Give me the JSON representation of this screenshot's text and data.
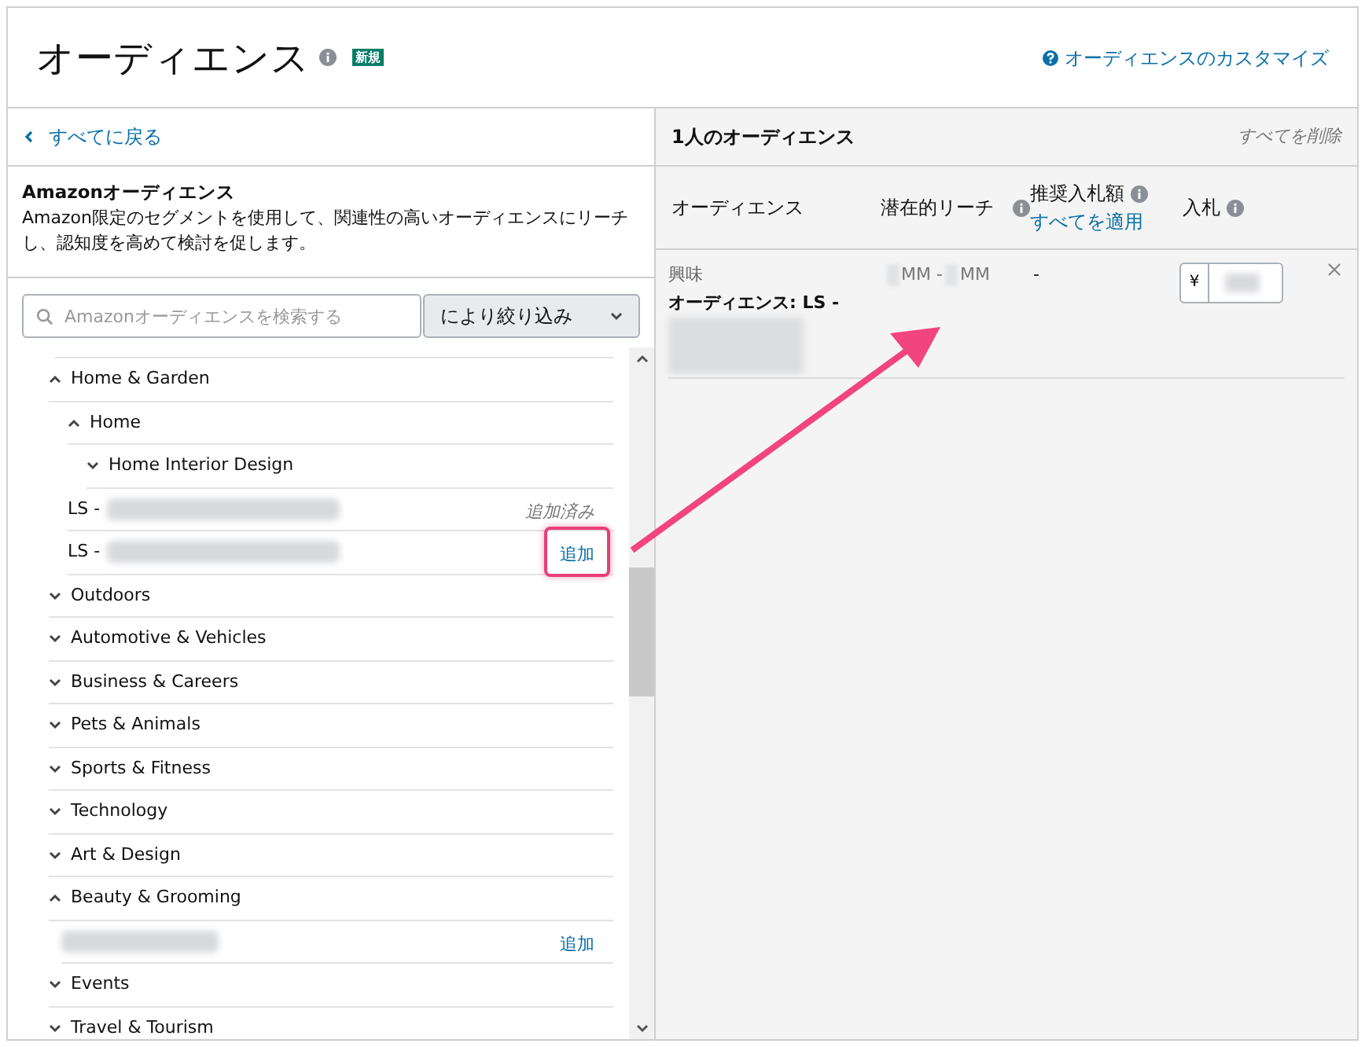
{
  "header": {
    "title": "オーディエンス",
    "badge": "新規",
    "customize_link": "オーディエンスのカスタマイズ"
  },
  "left": {
    "back_link": "すべてに戻る",
    "section_title": "Amazonオーディエンス",
    "section_description": "Amazon限定のセグメントを使用して、関連性の高いオーディエンスにリーチし、認知度を高めて検討を促します。",
    "search": {
      "placeholder": "Amazonオーディエンスを検索する"
    },
    "filter_button": "により絞り込み",
    "tree": [
      {
        "kind": "category",
        "label": "Home & Garden",
        "expanded": true,
        "children": [
          {
            "kind": "category",
            "label": "Home",
            "expanded": true,
            "children": [
              {
                "kind": "category",
                "label": "Home Interior Design",
                "expanded": false
              },
              {
                "kind": "segment",
                "label": "LS -",
                "action": "追加済み",
                "added": true,
                "highlighted": false
              },
              {
                "kind": "segment",
                "label": "LS -",
                "action": "追加",
                "added": false,
                "highlighted": true
              }
            ]
          }
        ]
      },
      {
        "kind": "category",
        "label": "Outdoors",
        "expanded": false
      },
      {
        "kind": "category",
        "label": "Automotive & Vehicles",
        "expanded": false
      },
      {
        "kind": "category",
        "label": "Business & Careers",
        "expanded": false
      },
      {
        "kind": "category",
        "label": "Pets & Animals",
        "expanded": false
      },
      {
        "kind": "category",
        "label": "Sports & Fitness",
        "expanded": false
      },
      {
        "kind": "category",
        "label": "Technology",
        "expanded": false
      },
      {
        "kind": "category",
        "label": "Art & Design",
        "expanded": false
      },
      {
        "kind": "category",
        "label": "Beauty & Grooming",
        "expanded": true,
        "children": [
          {
            "kind": "segment",
            "action": "追加",
            "added": false,
            "highlighted": false
          }
        ]
      },
      {
        "kind": "category",
        "label": "Events",
        "expanded": false
      },
      {
        "kind": "category",
        "label": "Travel & Tourism",
        "expanded": false
      }
    ]
  },
  "right": {
    "count_title": "1人のオーディエンス",
    "remove_all": "すべてを削除",
    "columns": [
      {
        "label": "オーディエンス",
        "info": false
      },
      {
        "label": "潜在的リーチ",
        "info": true
      },
      {
        "label": "推奨入札額",
        "info": true,
        "link": "すべてを適用"
      },
      {
        "label": "入札",
        "info": true
      }
    ],
    "rows": [
      {
        "type": "興味",
        "audience_label": "オーディエンス:",
        "audience_value": "LS -",
        "reach": [
          "MM -",
          "MM"
        ],
        "suggested": "-",
        "currency": "¥"
      }
    ]
  }
}
